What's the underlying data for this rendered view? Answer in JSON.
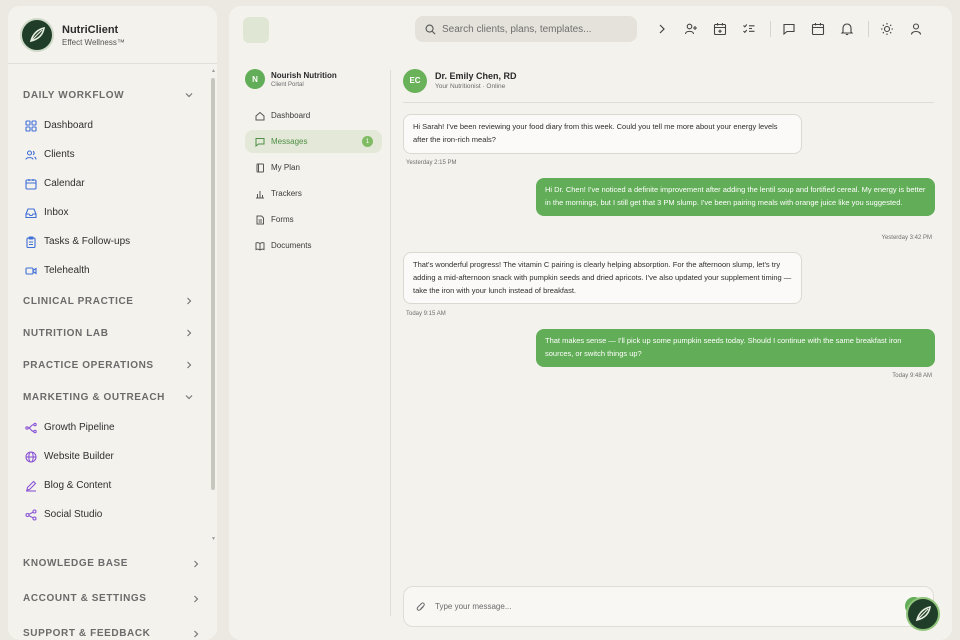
{
  "brand": {
    "name": "NutriClient",
    "subtitle": "Effect Wellness™"
  },
  "sidebar": {
    "sections": [
      {
        "label": "DAILY WORKFLOW",
        "expanded": true
      },
      {
        "label": "CLINICAL PRACTICE",
        "expanded": false
      },
      {
        "label": "NUTRITION LAB",
        "expanded": false
      },
      {
        "label": "PRACTICE OPERATIONS",
        "expanded": false
      },
      {
        "label": "MARKETING & OUTREACH",
        "expanded": true
      }
    ],
    "daily_items": [
      {
        "label": "Dashboard",
        "icon": "grid-icon"
      },
      {
        "label": "Clients",
        "icon": "users-icon"
      },
      {
        "label": "Calendar",
        "icon": "calendar-icon"
      },
      {
        "label": "Inbox",
        "icon": "inbox-icon"
      },
      {
        "label": "Tasks & Follow-ups",
        "icon": "clipboard-icon"
      },
      {
        "label": "Telehealth",
        "icon": "video-icon"
      }
    ],
    "marketing_items": [
      {
        "label": "Growth Pipeline",
        "icon": "flow-icon"
      },
      {
        "label": "Website Builder",
        "icon": "globe-icon"
      },
      {
        "label": "Blog & Content",
        "icon": "pen-icon"
      },
      {
        "label": "Social Studio",
        "icon": "share-icon"
      }
    ],
    "bottom_sections": [
      {
        "label": "KNOWLEDGE BASE"
      },
      {
        "label": "ACCOUNT & SETTINGS"
      },
      {
        "label": "SUPPORT & FEEDBACK"
      }
    ]
  },
  "search": {
    "placeholder": "Search clients, plans, templates..."
  },
  "portal": {
    "avatar": "N",
    "name": "Nourish Nutrition",
    "subtitle": "Client Portal",
    "items": [
      {
        "label": "Dashboard",
        "icon": "home-icon"
      },
      {
        "label": "Messages",
        "icon": "message-icon",
        "badge": "1",
        "active": true
      },
      {
        "label": "My Plan",
        "icon": "book-icon"
      },
      {
        "label": "Trackers",
        "icon": "bar-chart-icon"
      },
      {
        "label": "Forms",
        "icon": "document-icon"
      },
      {
        "label": "Documents",
        "icon": "open-book-icon"
      }
    ]
  },
  "chat": {
    "avatar": "EC",
    "name": "Dr. Emily Chen, RD",
    "status": "Your Nutritionist · Online",
    "messages": [
      {
        "from": "nutritionist",
        "text": "Hi Sarah! I've been reviewing your food diary from this week. Could you tell me more about your energy levels after the iron-rich meals?",
        "time": "Yesterday 2:15 PM"
      },
      {
        "from": "client",
        "text": "Hi Dr. Chen! I've noticed a definite improvement after adding the lentil soup and fortified cereal. My energy is better in the mornings, but I still get that 3 PM slump. I've been pairing meals with orange juice like you suggested.",
        "time": "Yesterday 3:42 PM"
      },
      {
        "from": "nutritionist",
        "text": "That's wonderful progress! The vitamin C pairing is clearly helping absorption. For the afternoon slump, let's try adding a mid-afternoon snack with pumpkin seeds and dried apricots. I've also updated your supplement timing — take the iron with your lunch instead of breakfast.",
        "time": "Today 9:15 AM"
      },
      {
        "from": "client",
        "text": "That makes sense — I'll pick up some pumpkin seeds today. Should I continue with the same breakfast iron sources, or switch things up?",
        "time": "Today 9:48 AM"
      }
    ],
    "composer_placeholder": "Type your message..."
  },
  "colors": {
    "accent": "#62ad57",
    "sidebar_bg": "#f4f2ed",
    "page_bg": "#ece9e2"
  }
}
